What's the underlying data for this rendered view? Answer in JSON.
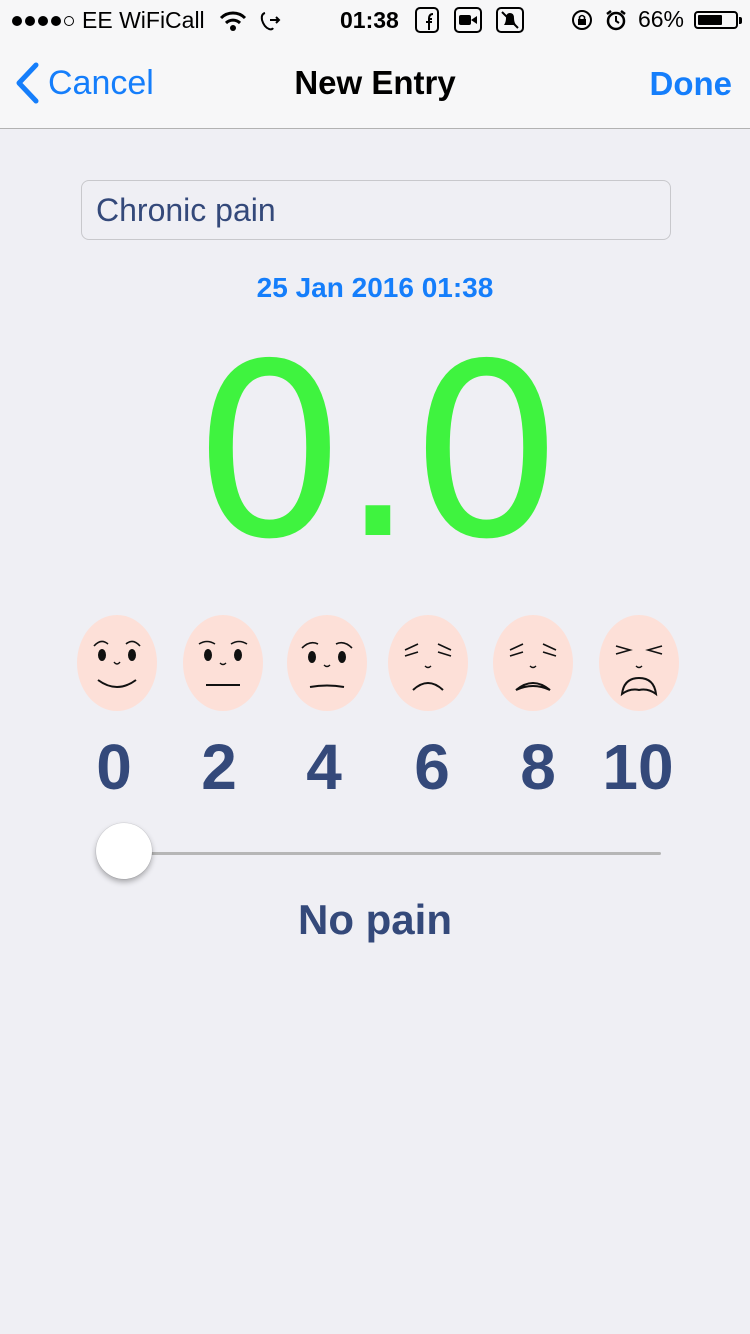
{
  "status_bar": {
    "carrier": "EE WiFiCall",
    "time": "01:38",
    "battery_percent": "66%",
    "battery_level": 0.66,
    "signal_bars_filled": 4,
    "signal_bars_total": 5,
    "icons": [
      "wifi-icon",
      "call-forward-icon",
      "facebook-icon",
      "video-icon",
      "bell-mute-icon",
      "rotation-lock-icon",
      "alarm-icon",
      "battery-icon"
    ]
  },
  "nav": {
    "cancel_label": "Cancel",
    "title": "New Entry",
    "done_label": "Done"
  },
  "entry": {
    "name_value": "Chronic pain",
    "date": "25 Jan 2016 01:38",
    "score": "0.0",
    "score_color": "#3ff33f"
  },
  "scale": {
    "labels": [
      "0",
      "2",
      "4",
      "6",
      "8",
      "10"
    ],
    "min": 0,
    "max": 10,
    "value": 0,
    "face_color": "#fde0d8",
    "label_color": "#34497a"
  },
  "pain_description": "No pain",
  "colors": {
    "accent": "#157efb",
    "background": "#efeff4"
  }
}
